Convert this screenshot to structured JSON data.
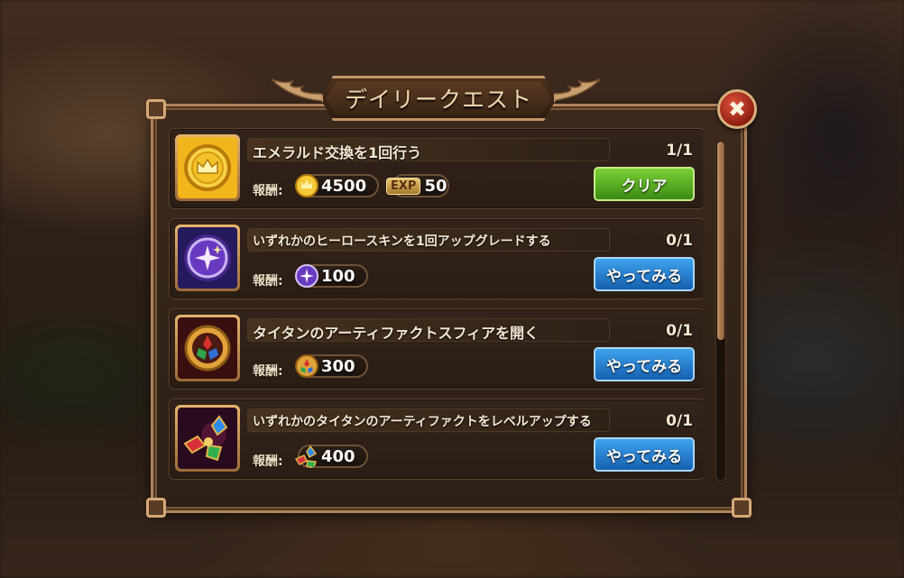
{
  "dialog": {
    "title": "デイリークエスト",
    "close_label": "✖"
  },
  "reward_label": "報酬:",
  "quests": [
    {
      "title": "エメラルド交換を1回行う",
      "progress": "1/1",
      "rewards": [
        {
          "icon": "gold-coin-icon",
          "value": "4500"
        },
        {
          "icon": "exp-icon",
          "tag": "EXP",
          "value": "50"
        }
      ],
      "button": {
        "label": "クリア",
        "style": "green"
      },
      "icon": "gold-crown-coin-icon"
    },
    {
      "title": "いずれかのヒーロースキンを1回アップグレードする",
      "progress": "0/1",
      "rewards": [
        {
          "icon": "skin-stone-icon",
          "value": "100"
        }
      ],
      "button": {
        "label": "やってみる",
        "style": "blue"
      },
      "icon": "purple-skin-stone-icon"
    },
    {
      "title": "タイタンのアーティファクトスフィアを開く",
      "progress": "0/1",
      "rewards": [
        {
          "icon": "titan-artifact-sphere-icon",
          "value": "300"
        }
      ],
      "button": {
        "label": "やってみる",
        "style": "blue"
      },
      "icon": "titan-artifact-sphere-icon"
    },
    {
      "title": "いずれかのタイタンのアーティファクトをレベルアップする",
      "progress": "0/1",
      "rewards": [
        {
          "icon": "titan-spark-icon",
          "value": "400"
        }
      ],
      "button": {
        "label": "やってみる",
        "style": "blue"
      },
      "icon": "titan-artifact-gems-icon"
    }
  ],
  "colors": {
    "frame": "#b0835a",
    "green_button": "#5aaf24",
    "blue_button": "#2a82d3",
    "close_button": "#c0392b"
  }
}
